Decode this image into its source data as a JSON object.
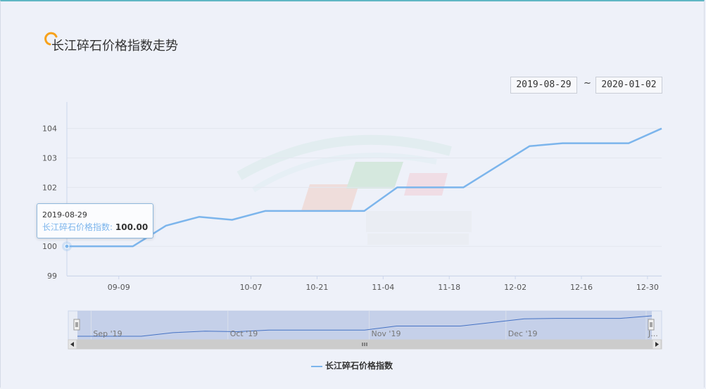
{
  "title": "长江碎石价格指数走势",
  "date_range": {
    "start": "2019-08-29",
    "separator": "~",
    "end": "2020-01-02"
  },
  "tooltip": {
    "date": "2019-08-29",
    "series": "长江碎石价格指数",
    "value": "100.00"
  },
  "navigator": {
    "labels": [
      "Sep '19",
      "Oct '19",
      "Nov '19",
      "Dec '19",
      "J..."
    ]
  },
  "colors": {
    "line": "#7cb5ec",
    "title_icon": "#f7a21b"
  },
  "chart_data": {
    "type": "line",
    "title": "长江碎石价格指数走势",
    "xlabel": "",
    "ylabel": "",
    "ylim": [
      99,
      104.9
    ],
    "xlim": [
      "2019-08-29",
      "2020-01-02"
    ],
    "yticks": [
      "99",
      "100",
      "102",
      "103",
      "104"
    ],
    "xticks": [
      "09-09",
      "10-07",
      "10-21",
      "11-04",
      "11-18",
      "12-02",
      "12-16",
      "12-30"
    ],
    "grid": true,
    "legend": "bottom",
    "series": [
      {
        "name": "长江碎石价格指数",
        "points": [
          [
            "2019-08-29",
            100.0
          ],
          [
            "2019-09-12",
            100.0
          ],
          [
            "2019-09-19",
            100.7
          ],
          [
            "2019-09-26",
            101.0
          ],
          [
            "2019-10-03",
            100.9
          ],
          [
            "2019-10-10",
            101.2
          ],
          [
            "2019-10-31",
            101.2
          ],
          [
            "2019-11-07",
            102.0
          ],
          [
            "2019-11-21",
            102.0
          ],
          [
            "2019-12-05",
            103.4
          ],
          [
            "2019-12-12",
            103.5
          ],
          [
            "2019-12-26",
            103.5
          ],
          [
            "2020-01-02",
            104.0
          ]
        ]
      }
    ]
  }
}
